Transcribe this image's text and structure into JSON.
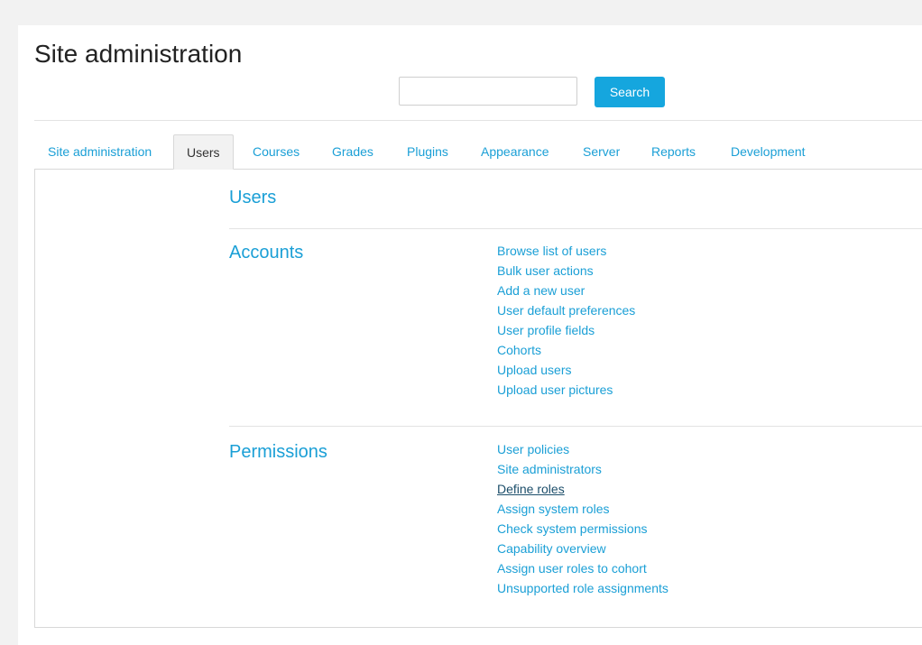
{
  "header": {
    "title": "Site administration",
    "search": {
      "value": "",
      "placeholder": "",
      "button_label": "Search"
    }
  },
  "tabs": [
    {
      "label": "Site administration",
      "active": false
    },
    {
      "label": "Users",
      "active": true
    },
    {
      "label": "Courses",
      "active": false
    },
    {
      "label": "Grades",
      "active": false
    },
    {
      "label": "Plugins",
      "active": false
    },
    {
      "label": "Appearance",
      "active": false
    },
    {
      "label": "Server",
      "active": false
    },
    {
      "label": "Reports",
      "active": false
    },
    {
      "label": "Development",
      "active": false
    }
  ],
  "main": {
    "heading": "Users",
    "sections": [
      {
        "title": "Accounts",
        "links": [
          "Browse list of users",
          "Bulk user actions",
          "Add a new user",
          "User default preferences",
          "User profile fields",
          "Cohorts",
          "Upload users",
          "Upload user pictures"
        ]
      },
      {
        "title": "Permissions",
        "links": [
          "User policies",
          "Site administrators",
          "Define roles",
          "Assign system roles",
          "Check system permissions",
          "Capability overview",
          "Assign user roles to cohort",
          "Unsupported role assignments"
        ],
        "hovered_link": "Define roles"
      }
    ]
  },
  "colors": {
    "link": "#1a9fd6",
    "button": "#15a6de",
    "hovered_link": "#1c4e6a"
  }
}
